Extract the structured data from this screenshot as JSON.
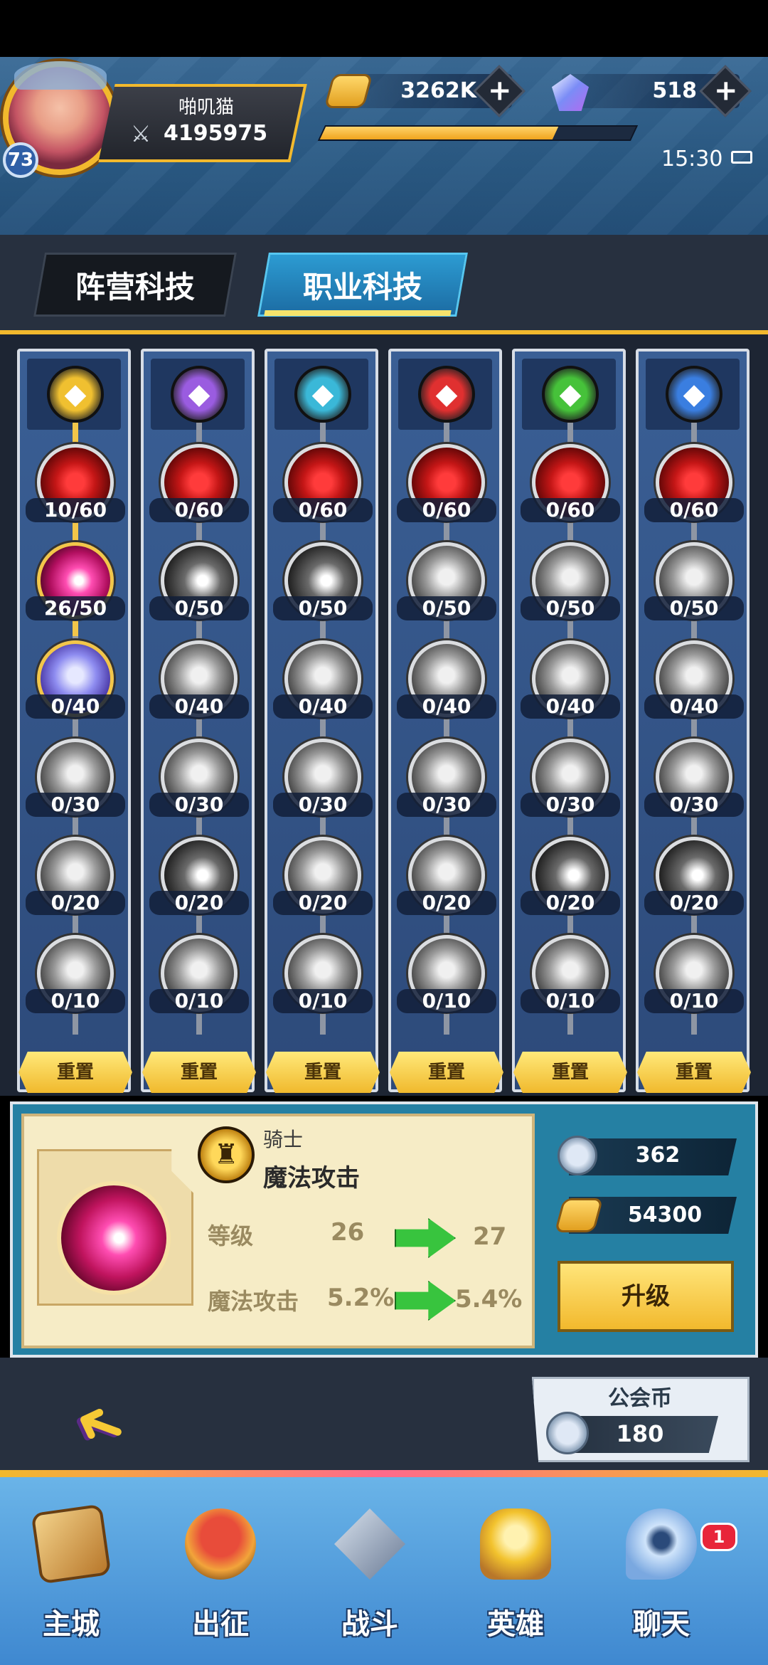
{
  "player": {
    "name": "啪叽猫",
    "power": "4195975",
    "level": "73"
  },
  "resources": {
    "gold": "3262K",
    "gems": "518",
    "exp_fraction": 0.75
  },
  "status": {
    "time": "15:30"
  },
  "tabs": [
    {
      "label": "阵营科技"
    },
    {
      "label": "职业科技"
    }
  ],
  "columns": [
    {
      "class_icon": "knight-icon",
      "icon_color": "#f0c030",
      "nodes": [
        "10/60",
        "26/50",
        "0/40",
        "0/30",
        "0/20",
        "0/10"
      ]
    },
    {
      "class_icon": "mage-icon",
      "icon_color": "#9a5ce0",
      "nodes": [
        "0/60",
        "0/50",
        "0/40",
        "0/30",
        "0/20",
        "0/10"
      ]
    },
    {
      "class_icon": "priest-icon",
      "icon_color": "#3ab8d8",
      "nodes": [
        "0/60",
        "0/50",
        "0/40",
        "0/30",
        "0/20",
        "0/10"
      ]
    },
    {
      "class_icon": "warrior-icon",
      "icon_color": "#e03030",
      "nodes": [
        "0/60",
        "0/50",
        "0/40",
        "0/30",
        "0/20",
        "0/10"
      ]
    },
    {
      "class_icon": "ranger-icon",
      "icon_color": "#46c23a",
      "nodes": [
        "0/60",
        "0/50",
        "0/40",
        "0/30",
        "0/20",
        "0/10"
      ]
    },
    {
      "class_icon": "assassin-icon",
      "icon_color": "#3a7ee0",
      "nodes": [
        "0/60",
        "0/50",
        "0/40",
        "0/30",
        "0/20",
        "0/10"
      ]
    }
  ],
  "reset_label": "重置",
  "detail": {
    "class_name": "骑士",
    "skill_name": "魔法攻击",
    "level_label": "等级",
    "level_current": "26",
    "level_next": "27",
    "stat_label": "魔法攻击",
    "stat_current": "5.2%",
    "stat_next": "5.4%",
    "cost_guild": "362",
    "cost_gold": "54300",
    "upgrade_label": "升级"
  },
  "guild": {
    "title": "公会币",
    "value": "180"
  },
  "nav": [
    {
      "label": "主城",
      "icon": "castle-book-icon"
    },
    {
      "label": "出征",
      "icon": "ship-icon"
    },
    {
      "label": "战斗",
      "icon": "crossed-swords-icon"
    },
    {
      "label": "英雄",
      "icon": "hero-helmet-icon"
    },
    {
      "label": "聊天",
      "icon": "chat-icon",
      "badge": "1"
    }
  ]
}
